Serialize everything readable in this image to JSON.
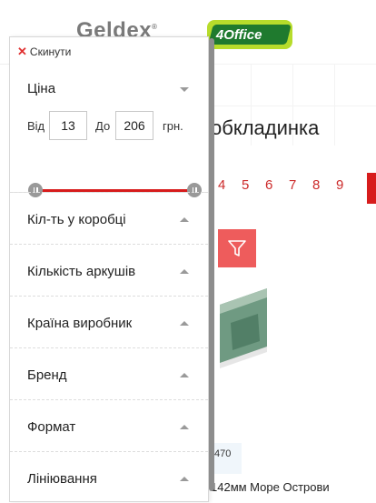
{
  "background": {
    "brands": [
      "Geldex",
      "4Office"
    ],
    "heading": "обкладинка",
    "pagination": [
      "4",
      "5",
      "6",
      "7",
      "8",
      "9"
    ],
    "product": {
      "code": "470",
      "title": "142мм Море Острови"
    }
  },
  "filter": {
    "reset_label": "Скинути",
    "price": {
      "title": "Ціна",
      "from_label": "Від",
      "from_value": "13",
      "to_label": "До",
      "to_value": "206",
      "currency": "грн."
    },
    "facets": [
      {
        "label": "Кіл-ть у коробці"
      },
      {
        "label": "Кількість аркушів"
      },
      {
        "label": "Країна виробник"
      },
      {
        "label": "Бренд"
      },
      {
        "label": "Формат"
      },
      {
        "label": "Лініювання"
      }
    ]
  },
  "colors": {
    "accent": "#d71c1c",
    "filter_button": "#ee5c5c",
    "reset_x": "#e03030"
  }
}
